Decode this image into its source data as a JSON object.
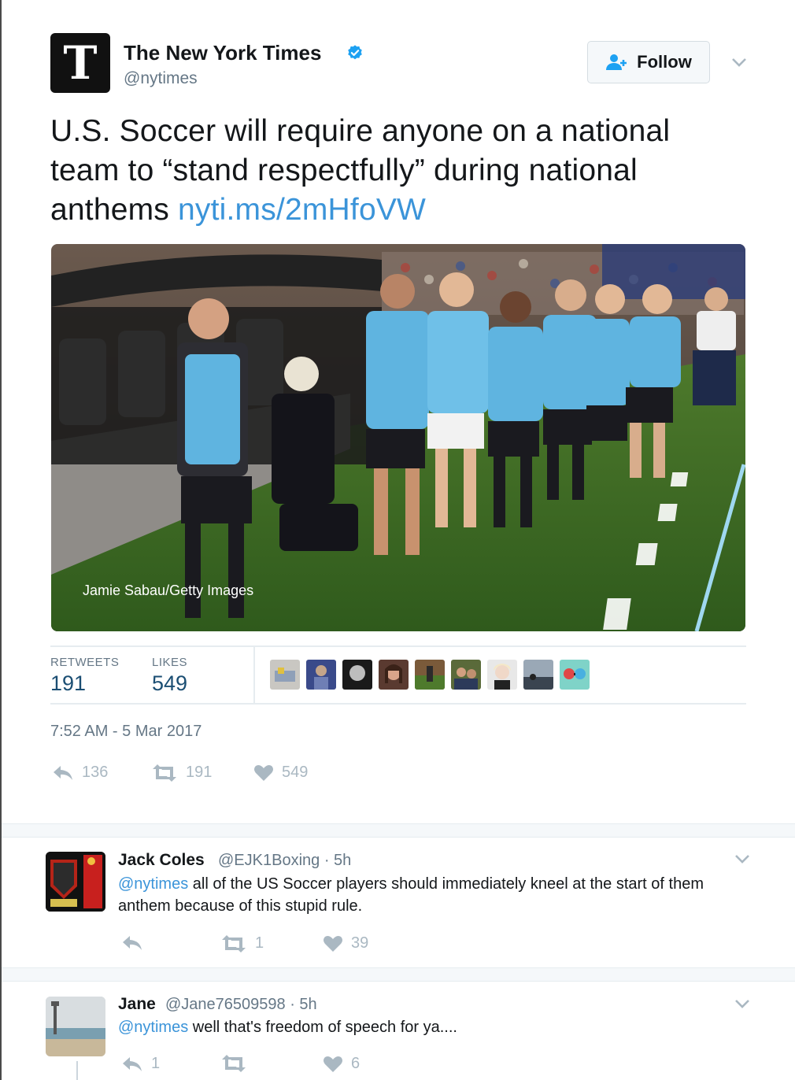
{
  "tweet": {
    "author_name": "The New York Times",
    "author_handle": "@nytimes",
    "avatar_glyph": "T",
    "follow_label": "Follow",
    "text": "U.S. Soccer will require anyone on a national team to “stand respectfully” during national anthems",
    "link": "nyti.ms/2mHfoVW",
    "photo_credit": "Jamie Sabau/Getty Images",
    "retweets_label": "RETWEETS",
    "retweets_count": "191",
    "likes_label": "LIKES",
    "likes_count": "549",
    "timestamp": "7:52 AM - 5 Mar 2017",
    "actions": {
      "reply": "136",
      "retweet": "191",
      "like": "549"
    }
  },
  "replies": [
    {
      "name": "Jack Coles",
      "handle": "@EJK1Boxing",
      "time": "· 5h",
      "mention": "@nytimes",
      "text": " all of the US Soccer players should immediately kneel at the start of them anthem because of this stupid rule.",
      "reply_count": "",
      "retweet_count": "1",
      "like_count": "39"
    },
    {
      "name": "Jane",
      "handle": "@Jane76509598",
      "time": "· 5h",
      "mention": "@nytimes",
      "text": " well that's freedom of speech for ya....",
      "reply_count": "1",
      "retweet_count": "",
      "like_count": "6"
    }
  ],
  "colors": {
    "link": "#3b94d9",
    "text": "#14171a",
    "secondary": "#657786",
    "icon": "#aab8c2",
    "verified": "#1da1f2"
  }
}
